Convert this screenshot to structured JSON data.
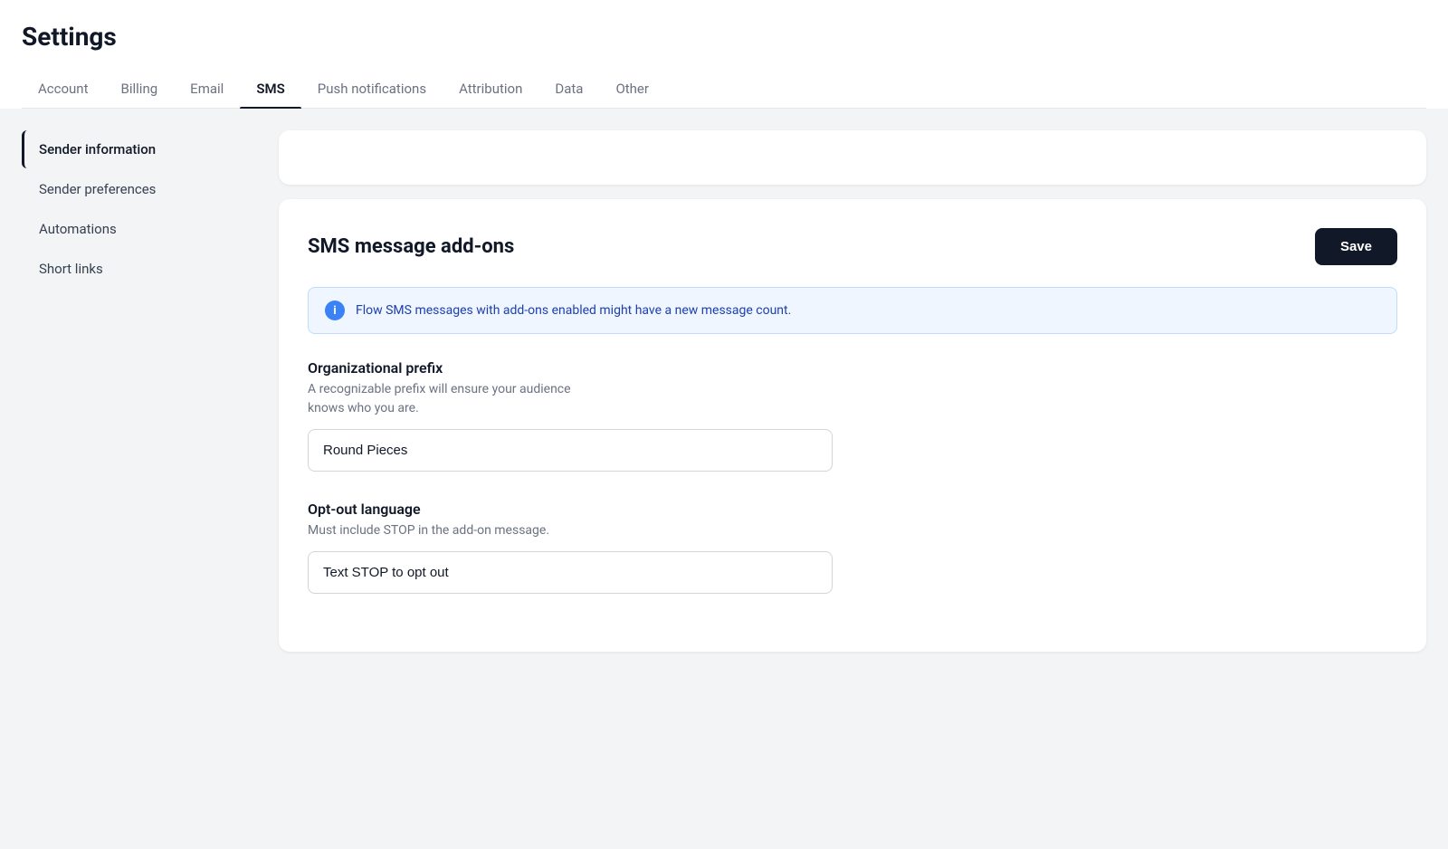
{
  "page": {
    "title": "Settings"
  },
  "tabs": [
    {
      "id": "account",
      "label": "Account",
      "active": false
    },
    {
      "id": "billing",
      "label": "Billing",
      "active": false
    },
    {
      "id": "email",
      "label": "Email",
      "active": false
    },
    {
      "id": "sms",
      "label": "SMS",
      "active": true
    },
    {
      "id": "push-notifications",
      "label": "Push notifications",
      "active": false
    },
    {
      "id": "attribution",
      "label": "Attribution",
      "active": false
    },
    {
      "id": "data",
      "label": "Data",
      "active": false
    },
    {
      "id": "other",
      "label": "Other",
      "active": false
    }
  ],
  "sidebar": {
    "items": [
      {
        "id": "sender-information",
        "label": "Sender information",
        "active": true
      },
      {
        "id": "sender-preferences",
        "label": "Sender preferences",
        "active": false
      },
      {
        "id": "automations",
        "label": "Automations",
        "active": false
      },
      {
        "id": "short-links",
        "label": "Short links",
        "active": false
      }
    ]
  },
  "card": {
    "title": "SMS message add-ons",
    "save_button_label": "Save",
    "info_banner": "Flow SMS messages with add-ons enabled might have a new message count.",
    "fields": {
      "org_prefix": {
        "label": "Organizational prefix",
        "description_line1": "A recognizable prefix will ensure your audience",
        "description_line2": "knows who you are.",
        "value": "Round Pieces"
      },
      "opt_out": {
        "label": "Opt-out language",
        "description": "Must include STOP in the add-on message.",
        "value": "Text STOP to opt out"
      }
    }
  }
}
